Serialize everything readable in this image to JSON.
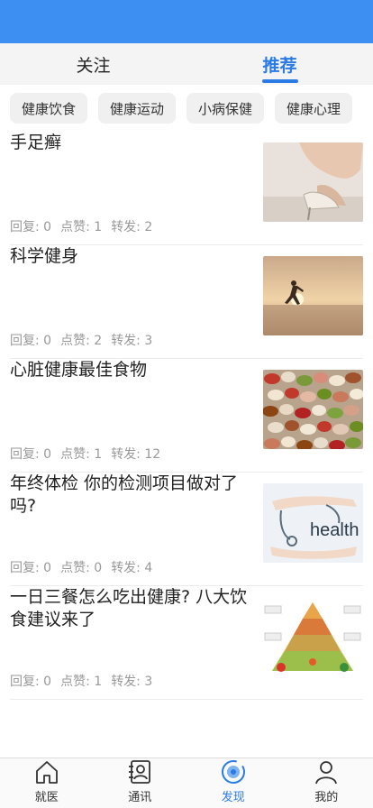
{
  "tabs": [
    {
      "label": "关注",
      "active": false
    },
    {
      "label": "推荐",
      "active": true
    }
  ],
  "categories": [
    "健康饮食",
    "健康运动",
    "小病保健",
    "健康心理"
  ],
  "articles": [
    {
      "title": "手足癣",
      "reply_label": "回复:",
      "reply": "0",
      "like_label": "点赞:",
      "like": "1",
      "share_label": "转发:",
      "share": "2",
      "image": "high-heel-shoe-photo"
    },
    {
      "title": "科学健身",
      "reply_label": "回复:",
      "reply": "0",
      "like_label": "点赞:",
      "like": "2",
      "share_label": "转发:",
      "share": "3",
      "image": "runner-sunset-photo"
    },
    {
      "title": "心脏健康最佳食物",
      "reply_label": "回复:",
      "reply": "0",
      "like_label": "点赞:",
      "like": "1",
      "share_label": "转发:",
      "share": "12",
      "image": "beans-photo"
    },
    {
      "title": "年终体检 你的检测项目做对了吗?",
      "reply_label": "回复:",
      "reply": "0",
      "like_label": "点赞:",
      "like": "0",
      "share_label": "转发:",
      "share": "4",
      "image": "stethoscope-health-photo"
    },
    {
      "title": "一日三餐怎么吃出健康? 八大饮食建议来了",
      "reply_label": "回复:",
      "reply": "0",
      "like_label": "点赞:",
      "like": "1",
      "share_label": "转发:",
      "share": "3",
      "image": "food-pyramid-photo"
    }
  ],
  "nav": [
    {
      "label": "就医",
      "icon": "home-icon",
      "active": false
    },
    {
      "label": "通讯",
      "icon": "contacts-icon",
      "active": false
    },
    {
      "label": "发现",
      "icon": "discover-icon",
      "active": true
    },
    {
      "label": "我的",
      "icon": "profile-icon",
      "active": false
    }
  ],
  "colors": {
    "statusbar": "#3d8ff2",
    "accent": "#2b7be5",
    "meta_text": "#999999"
  }
}
